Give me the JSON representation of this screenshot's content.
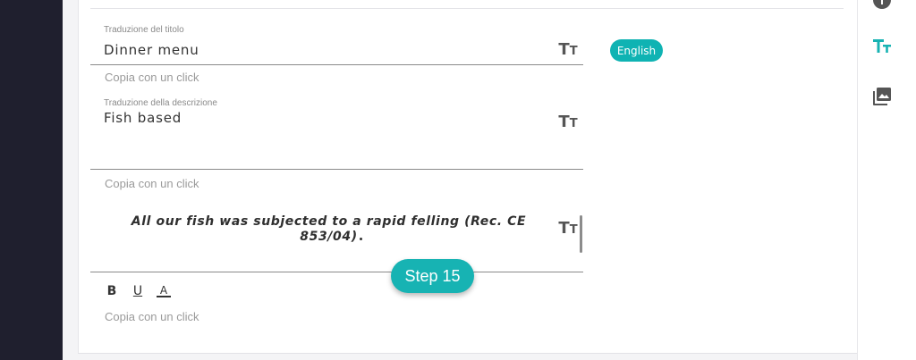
{
  "form": {
    "title_field": {
      "label": "Traduzione del titolo",
      "value": "Dinner menu"
    },
    "description_field": {
      "label": "Traduzione della descrizione",
      "value": "Fish based"
    },
    "rich_field": {
      "value": "All our fish was subjected to a rapid felling (Rec. CE 853/04)"
    },
    "copy_label": "Copia con un click",
    "format_toolbar": {
      "bold": "B",
      "underline": "U",
      "color": "A"
    },
    "text_size_icon": {
      "big": "T",
      "small": "T"
    }
  },
  "language_badge": "English",
  "tutorial": {
    "step_label": "Step 15"
  },
  "colors": {
    "accent": "#17b3b3",
    "sidebar": "#1f1f2e"
  },
  "right_panel": {
    "icons": [
      "info-icon",
      "text-size-icon",
      "image-gallery-icon"
    ]
  }
}
